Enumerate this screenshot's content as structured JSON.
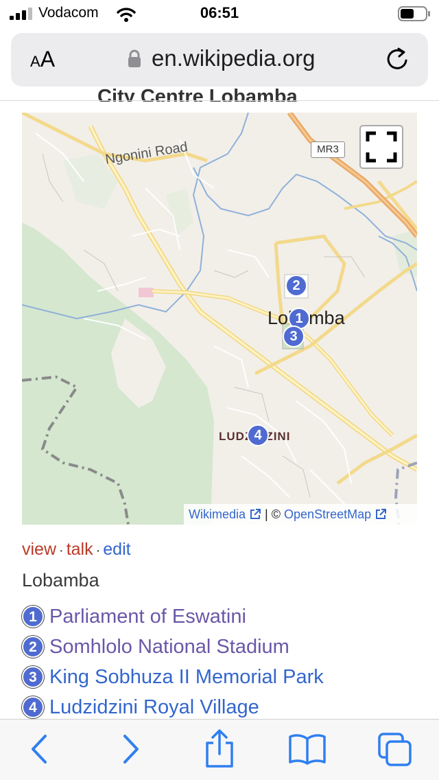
{
  "status_bar": {
    "carrier": "Vodacom",
    "time": "06:51"
  },
  "address_bar": {
    "text_size_label_small": "A",
    "text_size_label_large": "A",
    "url": "en.wikipedia.org"
  },
  "page": {
    "cut_heading": "City Centre Lobamba",
    "map": {
      "road_label": "Ngonini Road",
      "town_label": "Lobamba",
      "village_label": "LUDZIDZINI",
      "road_shield": "MR3",
      "markers": [
        "1",
        "2",
        "3",
        "4"
      ],
      "attribution": {
        "wikimedia": "Wikimedia",
        "separator": "|",
        "copyright": "©",
        "osm": "OpenStreetMap"
      }
    },
    "actions": {
      "view": "view",
      "talk": "talk",
      "edit": "edit",
      "dot": "·"
    },
    "caption": "Lobamba",
    "legend": [
      {
        "num": "1",
        "label": "Parliament of Eswatini"
      },
      {
        "num": "2",
        "label": "Somhlolo National Stadium"
      },
      {
        "num": "3",
        "label": "King Sobhuza II Memorial Park"
      },
      {
        "num": "4",
        "label": "Ludzidzini Royal Village"
      }
    ]
  },
  "colors": {
    "link_blue": "#3366cc",
    "visited_purple": "#6b57a8",
    "red_link": "#ba3b2a",
    "marker_blue": "#4f6bd1",
    "ios_blue": "#2f7ff0"
  },
  "toolbar": {
    "icons": [
      "back-icon",
      "forward-icon",
      "share-icon",
      "bookmarks-icon",
      "tabs-icon"
    ]
  }
}
